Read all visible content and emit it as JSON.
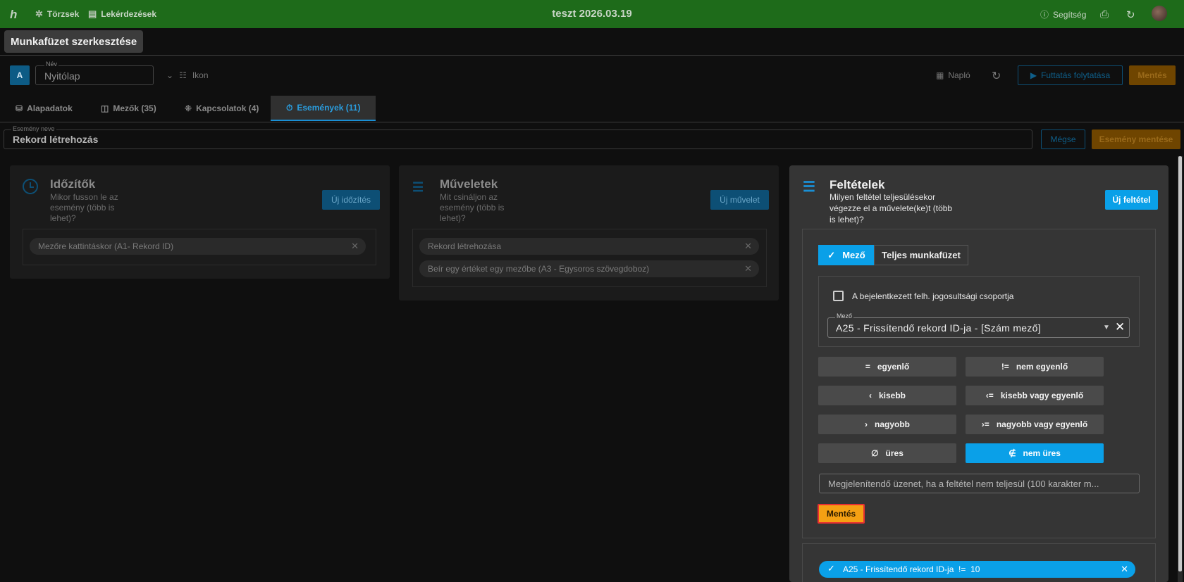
{
  "topbar": {
    "logo": "h",
    "nav": [
      {
        "label": "Törzsek",
        "icon": "asterisk-icon"
      },
      {
        "label": "Lekérdezések",
        "icon": "document-icon"
      }
    ],
    "title": "teszt 2026.03.19",
    "help_label": "Segítség"
  },
  "tooltip": "Munkafüzet szerkesztése",
  "header": {
    "badge": "A",
    "name_label": "Név",
    "name_value": "Nyitólap",
    "icon_label": "Ikon",
    "log_label": "Napló",
    "run_label": "Futtatás folytatása",
    "save_label": "Mentés"
  },
  "tabs": [
    {
      "label": "Alapadatok"
    },
    {
      "label": "Mezők (35)"
    },
    {
      "label": "Kapcsolatok (4)"
    },
    {
      "label": "Események (11)",
      "active": true
    }
  ],
  "event": {
    "name_label": "Esemény neve",
    "name_value": "Rekord létrehozás",
    "cancel_label": "Mégse",
    "save_label": "Esemény mentése"
  },
  "timers": {
    "title": "Időzítők",
    "subtitle_lines": [
      "Mikor fusson le az",
      "esemény (több is",
      "lehet)?"
    ],
    "new_label": "Új időzítés",
    "items": [
      "Mezőre kattintáskor  (A1- Rekord ID)"
    ]
  },
  "operations": {
    "title": "Műveletek",
    "subtitle_lines": [
      "Mit csináljon az",
      "esemény (több is",
      "lehet)?"
    ],
    "new_label": "Új művelet",
    "items": [
      "Rekord létrehozása",
      "Beír egy értéket egy mezőbe  (A3 - Egysoros szövegdoboz)"
    ]
  },
  "conditions": {
    "title": "Feltételek",
    "subtitle_lines": [
      "Milyen feltétel teljesülésekor",
      "végezze el a művelete(ke)t (több",
      "is lehet)?"
    ],
    "new_label": "Új feltétel",
    "mode_options": [
      "Mező",
      "Teljes munkafüzet"
    ],
    "checkbox_label": "A bejelentkezett felh. jogosultsági csoportja",
    "field_label": "Mező",
    "field_value": "A25 - Frissítendő rekord ID-ja - [Szám mező]",
    "operators": [
      {
        "symbol": "=",
        "label": "egyenlő"
      },
      {
        "symbol": "!=",
        "label": "nem egyenlő"
      },
      {
        "symbol": "‹",
        "label": "kisebb"
      },
      {
        "symbol": "‹=",
        "label": "kisebb vagy egyenlő"
      },
      {
        "symbol": "›",
        "label": "nagyobb"
      },
      {
        "symbol": "›=",
        "label": "nagyobb vagy egyenlő"
      },
      {
        "symbol": "∅",
        "label": "üres"
      },
      {
        "symbol": "∉",
        "label": "nem üres",
        "selected": true
      }
    ],
    "message_placeholder": "Megjelenítendő üzenet, ha a feltétel nem teljesül (100 karakter m...",
    "save_label": "Mentés",
    "existing": [
      "A25 - Frissítendő rekord ID-ja  !=  10"
    ]
  }
}
